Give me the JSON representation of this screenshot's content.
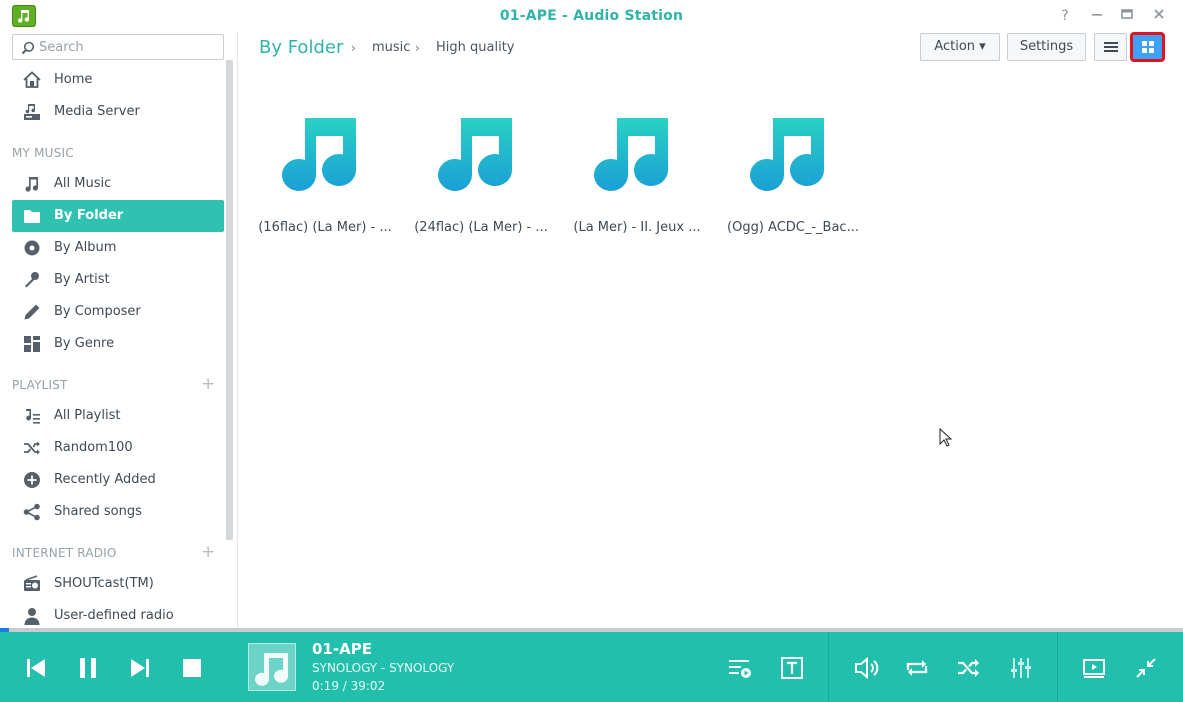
{
  "window": {
    "title": "01-APE - Audio Station",
    "help": "?",
    "minimize": "—",
    "maximize": "□",
    "close": "✕"
  },
  "search": {
    "placeholder": "Search",
    "value": ""
  },
  "sidebar": {
    "top_items": [
      {
        "label": "Home",
        "icon": "home-icon"
      },
      {
        "label": "Media Server",
        "icon": "media-server-icon"
      }
    ],
    "sections": {
      "my_music": "MY MUSIC",
      "playlist": "PLAYLIST",
      "internet_radio": "INTERNET RADIO",
      "add_symbol": "+"
    },
    "my_music_items": [
      {
        "label": "All Music",
        "icon": "music-note-icon"
      },
      {
        "label": "By Folder",
        "icon": "folder-icon",
        "active": true
      },
      {
        "label": "By Album",
        "icon": "album-icon"
      },
      {
        "label": "By Artist",
        "icon": "microphone-icon"
      },
      {
        "label": "By Composer",
        "icon": "pen-icon"
      },
      {
        "label": "By Genre",
        "icon": "genre-grid-icon"
      }
    ],
    "playlist_items": [
      {
        "label": "All Playlist",
        "icon": "playlist-icon"
      },
      {
        "label": "Random100",
        "icon": "shuffle-icon"
      },
      {
        "label": "Recently Added",
        "icon": "plus-circle-icon"
      },
      {
        "label": "Shared songs",
        "icon": "share-icon"
      }
    ],
    "radio_items": [
      {
        "label": "SHOUTcast(TM)",
        "icon": "radio-icon"
      },
      {
        "label": "User-defined radio",
        "icon": "user-icon"
      }
    ]
  },
  "breadcrumb": {
    "root": "By Folder",
    "parts": [
      "music",
      "High quality"
    ],
    "separator": "›"
  },
  "toolbar": {
    "action_label": "Action ▾",
    "settings_label": "Settings",
    "view_mode": "grid"
  },
  "files": [
    {
      "name": "(16flac) (La Mer) - ..."
    },
    {
      "name": "(24flac) (La Mer) - ..."
    },
    {
      "name": "(La Mer) - II. Jeux ..."
    },
    {
      "name": "(Ogg) ACDC_-_Bac..."
    }
  ],
  "player": {
    "title": "01-APE",
    "artist_line": "SYNOLOGY - SYNOLOGY",
    "time": "0:19 / 39:02",
    "progress": 0.008
  },
  "colors": {
    "accent": "#2fc2b1",
    "player_bg": "#22c0ac",
    "note_top": "#2ad1c4",
    "note_bottom": "#1a9fd6",
    "highlight_border": "#e0141f",
    "grid_button": "#3fa1f6"
  }
}
